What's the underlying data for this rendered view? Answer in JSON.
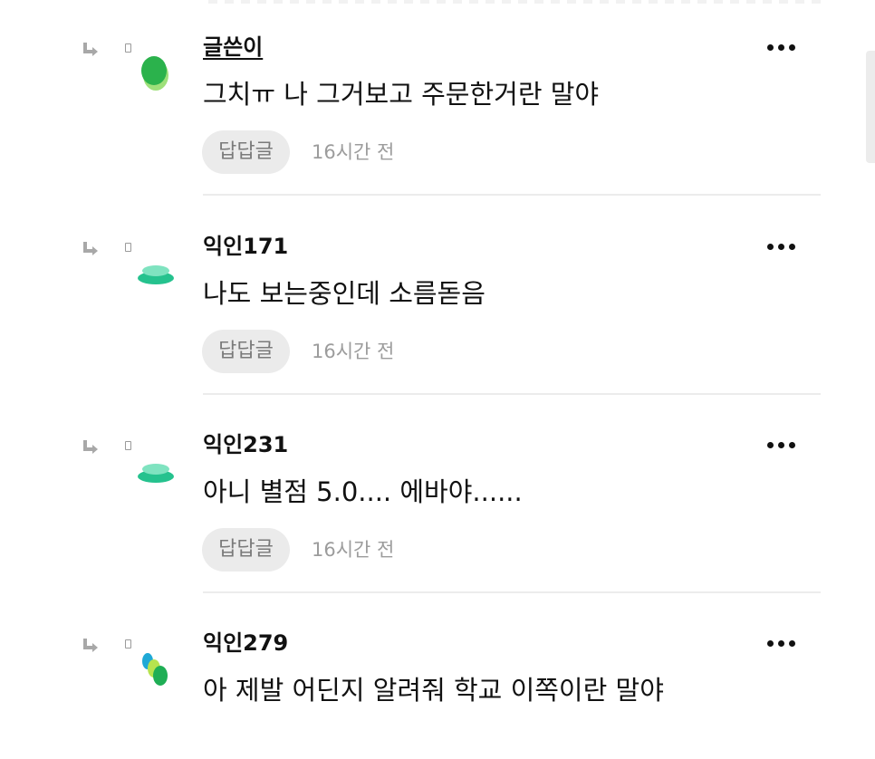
{
  "comments": [
    {
      "author": "글쓴이",
      "body": "그치ㅠ 나 그거보고 주문한거란 말야",
      "reply_label": "답답글",
      "time": "16시간 전",
      "avatar": "green-oval-avatar"
    },
    {
      "author": "익인171",
      "body": "나도 보는중인데 소름돋음",
      "reply_label": "답답글",
      "time": "16시간 전",
      "avatar": "teal-stack-avatar"
    },
    {
      "author": "익인231",
      "body": "아니 별점 5.0.... 에바야......",
      "reply_label": "답답글",
      "time": "16시간 전",
      "avatar": "teal-stack-avatar"
    },
    {
      "author": "익인279",
      "body": "아 제발 어딘지 알려줘 학교 이쪽이란 말야",
      "avatar": "tri-color-avatar"
    }
  ],
  "icons": {
    "reply": "reply-arrow-icon",
    "more": "more-dots-icon"
  },
  "colors": {
    "green": "#3dbb5c",
    "teal": "#2cc99a",
    "chip_bg": "#ebebeb",
    "meta_text": "#9c9c9c"
  }
}
